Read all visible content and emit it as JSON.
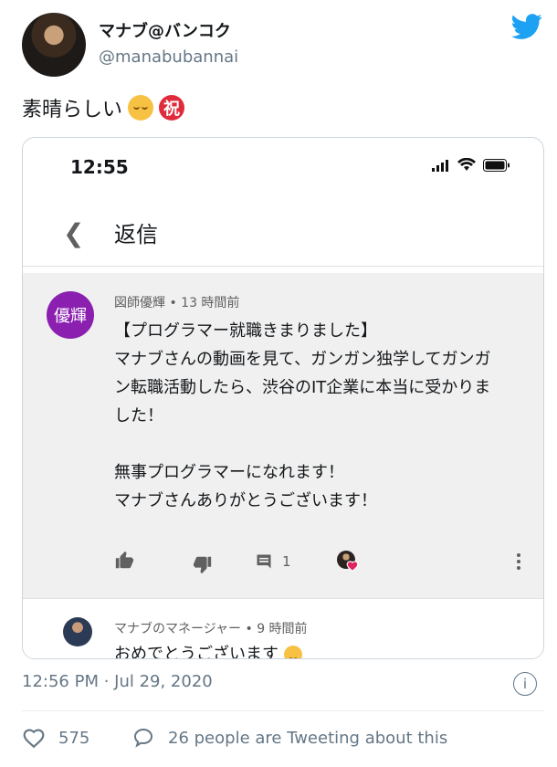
{
  "user": {
    "name": "マナブ@バンコク",
    "handle": "@manabubannai"
  },
  "tweet": {
    "text": "素晴らしい",
    "emoji": [
      "relieved-face",
      "shuku-celebration"
    ],
    "shuku_char": "祝",
    "timestamp": "12:56 PM · Jul 29, 2020",
    "like_count": "575",
    "conversation_text": "26 people are Tweeting about this"
  },
  "screenshot": {
    "status_time": "12:55",
    "nav_title": "返信",
    "comment": {
      "avatar_text": "優輝",
      "author": "図師優輝",
      "age": "13 時間前",
      "lines": [
        "【プログラマー就職きまりました】",
        "マナブさんの動画を見て、ガンガン独学してガンガ",
        "ン転職活動したら、渋谷のIT企業に本当に受かりま",
        "した！",
        "",
        "無事プログラマーになれます！",
        "マナブさんありがとうございます！"
      ],
      "reply_count": "1"
    },
    "reply": {
      "author": "マナブのマネージャー",
      "age": "9 時間前",
      "text": "おめでとうございます"
    }
  },
  "colors": {
    "twitter_blue": "#1da1f2",
    "muted": "#657786",
    "comment_bg": "#f0f0f0",
    "commenter_avatar": "#8a1fb0",
    "heart_red": "#e0245e"
  }
}
